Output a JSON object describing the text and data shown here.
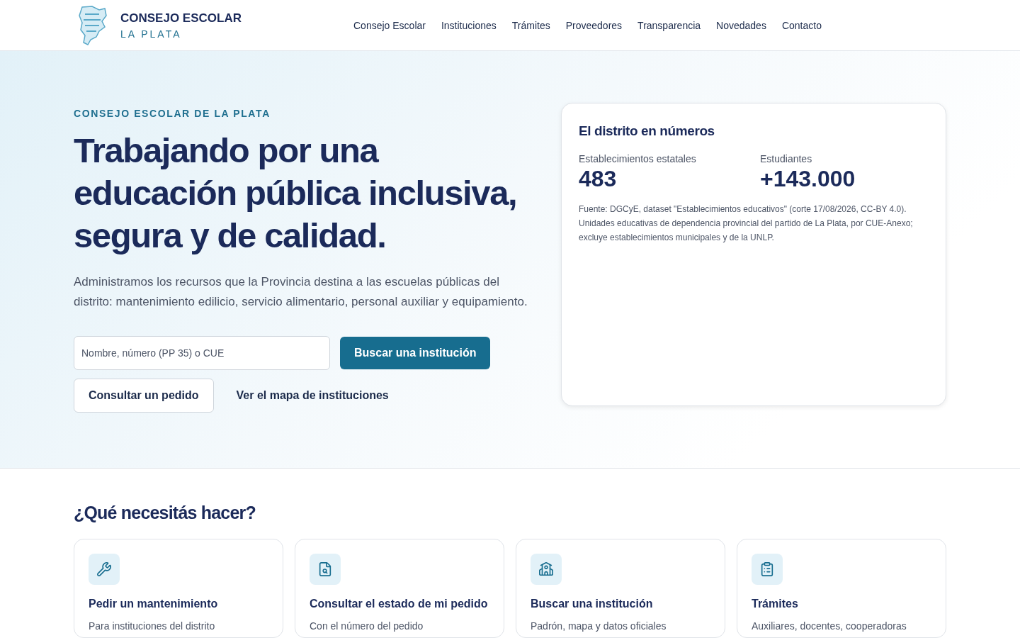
{
  "brand": {
    "title": "CONSEJO ESCOLAR",
    "subtitle": "LA PLATA"
  },
  "nav": [
    "Consejo Escolar",
    "Instituciones",
    "Trámites",
    "Proveedores",
    "Transparencia",
    "Novedades",
    "Contacto"
  ],
  "hero": {
    "eyebrow": "CONSEJO ESCOLAR DE LA PLATA",
    "title_lines": [
      "Trabajando por una",
      "educación pública inclusiva,",
      "segura y de calidad."
    ],
    "lead": "Administramos los recursos que la Provincia destina a las escuelas públicas del distrito: mantenimiento edilicio, servicio alimentario, personal auxiliar y equipamiento.",
    "search": {
      "placeholder": "Nombre, número (PP 35) o CUE"
    },
    "search_button": "Buscar una institución",
    "secondary_button": "Consultar un pedido",
    "map_link": "Ver el mapa de instituciones"
  },
  "stats": {
    "title": "El distrito en números",
    "items": [
      {
        "label": "Establecimientos estatales",
        "value": "483"
      },
      {
        "label": "Estudiantes",
        "value": "+143.000"
      }
    ],
    "source": "Fuente: DGCyE, dataset \"Establecimientos educativos\" (corte 17/08/2026, CC-BY 4.0). Unidades educativas de dependencia provincial del partido de La Plata, por CUE-Anexo; excluye establecimientos municipales y de la UNLP."
  },
  "tasks": {
    "title": "¿Qué necesitás hacer?",
    "cards": [
      {
        "kind": "wrench",
        "title": "Pedir un mantenimiento",
        "text": "Para instituciones del distrito"
      },
      {
        "kind": "search-file",
        "title": "Consultar el estado de mi pedido",
        "text": "Con el número del pedido"
      },
      {
        "kind": "school",
        "title": "Buscar una institución",
        "text": "Padrón, mapa y datos oficiales"
      },
      {
        "kind": "clipboard",
        "title": "Trámites",
        "text": "Auxiliares, docentes, cooperadoras"
      }
    ]
  }
}
